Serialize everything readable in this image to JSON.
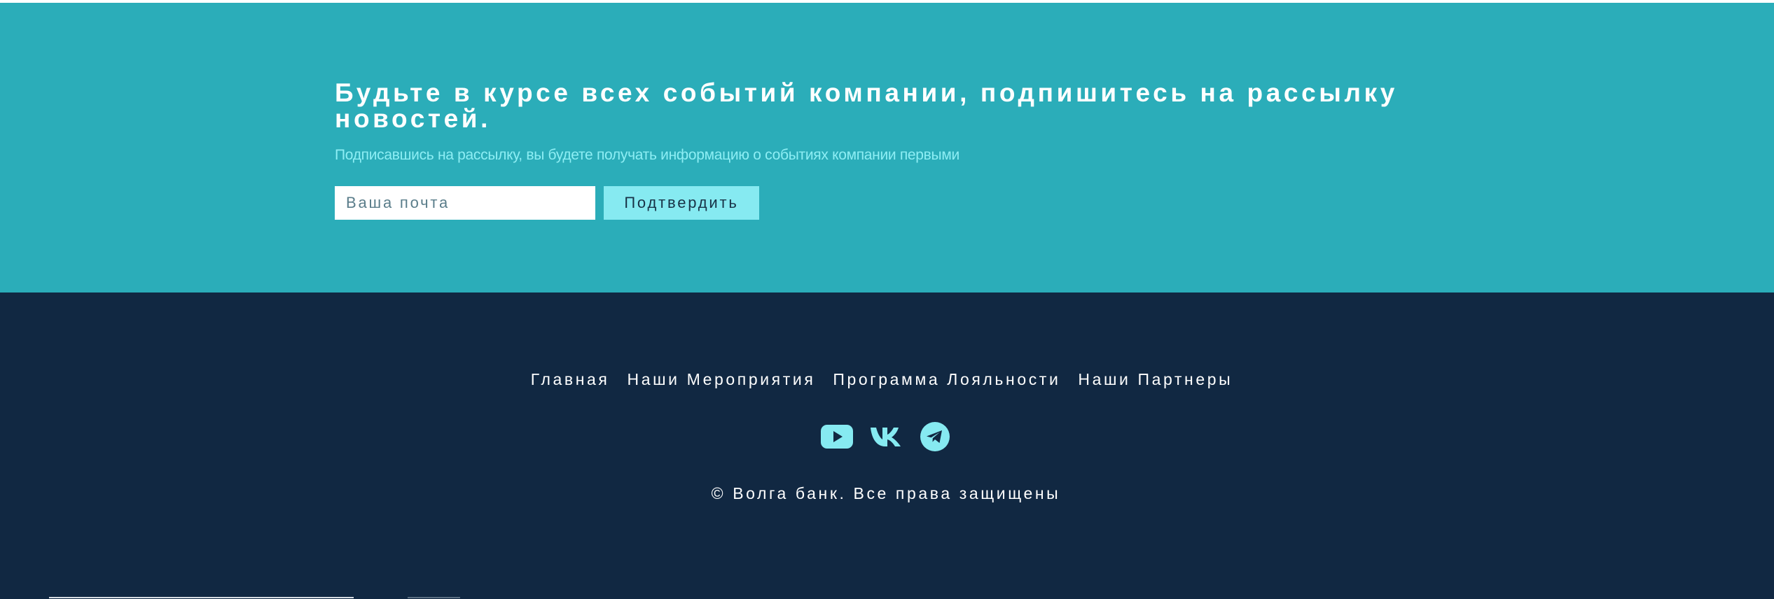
{
  "newsletter": {
    "title": "Будьте в курсе всех событий компании, подпишитесь на рассылку новостей.",
    "subtitle": "Подписавшись на рассылку, вы будете получать информацию о событиях компании первыми",
    "email_placeholder": "Ваша почта",
    "email_value": "",
    "submit_label": "Подтвердить"
  },
  "footer": {
    "nav": [
      {
        "label": "Главная"
      },
      {
        "label": "Наши Мероприятия"
      },
      {
        "label": "Программа Лояльности"
      },
      {
        "label": "Наши Партнеры"
      }
    ],
    "socials": [
      {
        "icon": "youtube-icon"
      },
      {
        "icon": "vk-icon"
      },
      {
        "icon": "telegram-icon"
      }
    ],
    "copyright": "© Волга банк. Все права защищены"
  },
  "colors": {
    "newsletter_bg": "#2badb9",
    "footer_bg": "#112842",
    "accent": "#86eaf1",
    "subtitle": "#8deef4"
  }
}
